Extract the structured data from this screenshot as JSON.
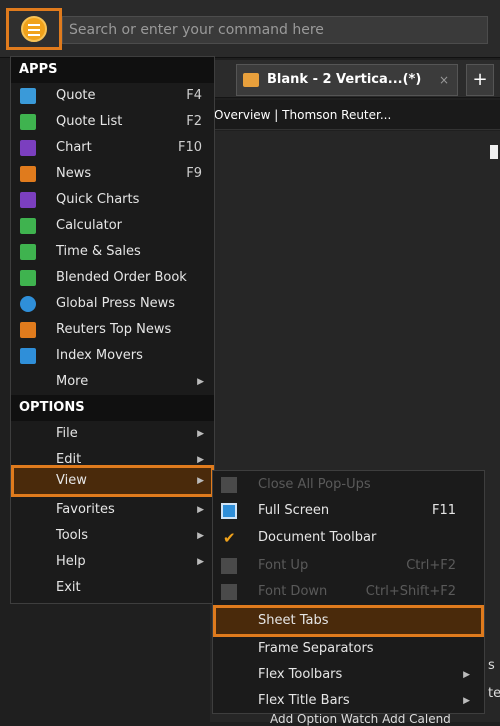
{
  "topbar": {
    "search_placeholder": "Search or enter your command here"
  },
  "tabs": {
    "active_label": "Blank - 2 Vertica...(*)",
    "close": "×",
    "add": "+"
  },
  "document": {
    "title": "Overview | Thomson Reuter..."
  },
  "peeks": {
    "right1": "s",
    "right2": "te",
    "bottom": "Add Option Watch   Add Calend"
  },
  "menu": {
    "apps_header": "APPS",
    "options_header": "OPTIONS",
    "apps": [
      {
        "label": "Quote",
        "shortcut": "F4",
        "icon": "quote-icon",
        "color": "#3a9ad9"
      },
      {
        "label": "Quote List",
        "shortcut": "F2",
        "icon": "quote-list-icon",
        "color": "#3fb34f"
      },
      {
        "label": "Chart",
        "shortcut": "F10",
        "icon": "chart-icon",
        "color": "#7b3fbf"
      },
      {
        "label": "News",
        "shortcut": "F9",
        "icon": "news-icon",
        "color": "#e07b1d"
      },
      {
        "label": "Quick Charts",
        "shortcut": "",
        "icon": "quick-charts-icon",
        "color": "#7b3fbf"
      },
      {
        "label": "Calculator",
        "shortcut": "",
        "icon": "calculator-icon",
        "color": "#3fb34f"
      },
      {
        "label": "Time & Sales",
        "shortcut": "",
        "icon": "time-sales-icon",
        "color": "#3fb34f"
      },
      {
        "label": "Blended Order Book",
        "shortcut": "",
        "icon": "order-book-icon",
        "color": "#3fb34f"
      },
      {
        "label": "Global Press News",
        "shortcut": "",
        "icon": "globe-icon",
        "color": "#2f8fd9"
      },
      {
        "label": "Reuters Top News",
        "shortcut": "",
        "icon": "top-news-icon",
        "color": "#e07b1d"
      },
      {
        "label": "Index Movers",
        "shortcut": "",
        "icon": "index-movers-icon",
        "color": "#2f8fd9"
      },
      {
        "label": "More",
        "shortcut": "",
        "icon": "",
        "color": ""
      }
    ],
    "options": [
      {
        "label": "File"
      },
      {
        "label": "Edit"
      },
      {
        "label": "View"
      },
      {
        "label": "Favorites"
      },
      {
        "label": "Tools"
      },
      {
        "label": "Help"
      },
      {
        "label": "Exit"
      }
    ]
  },
  "view_submenu": [
    {
      "label": "Close All Pop-Ups",
      "shortcut": "",
      "disabled": true
    },
    {
      "label": "Full Screen",
      "shortcut": "F11",
      "disabled": false
    },
    {
      "label": "Document Toolbar",
      "shortcut": "",
      "checked": true
    },
    {
      "label": "Font Up",
      "shortcut": "Ctrl+F2",
      "disabled": true
    },
    {
      "label": "Font Down",
      "shortcut": "Ctrl+Shift+F2",
      "disabled": true
    },
    {
      "label": "Sheet Tabs",
      "shortcut": ""
    },
    {
      "label": "Frame Separators",
      "shortcut": ""
    },
    {
      "label": "Flex Toolbars",
      "shortcut": ""
    },
    {
      "label": "Flex Title Bars",
      "shortcut": ""
    }
  ],
  "colors": {
    "accent": "#e07b1d",
    "logo": "#f0a21b"
  }
}
